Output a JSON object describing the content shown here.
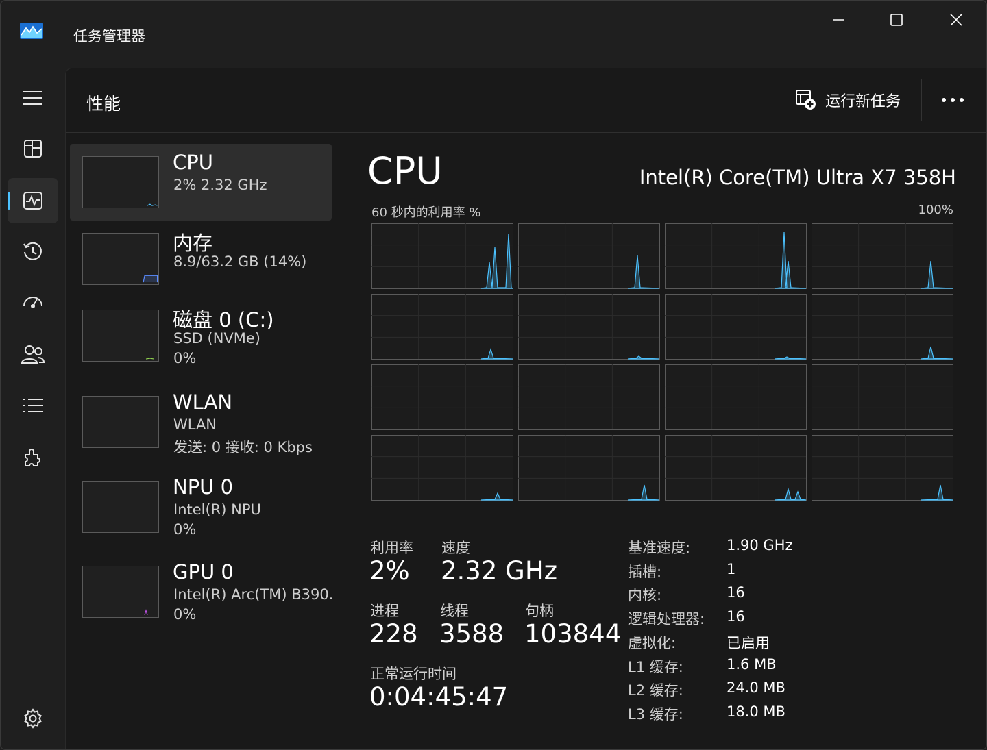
{
  "window": {
    "title": "任务管理器",
    "accent": "#4cc2ff"
  },
  "nav": {
    "items": [
      {
        "icon": "hamburger-menu-icon"
      },
      {
        "icon": "processes-icon"
      },
      {
        "icon": "performance-icon",
        "active": true
      },
      {
        "icon": "app-history-icon"
      },
      {
        "icon": "startup-apps-icon"
      },
      {
        "icon": "users-icon"
      },
      {
        "icon": "details-icon"
      },
      {
        "icon": "services-icon"
      },
      {
        "icon": "settings-icon"
      }
    ]
  },
  "header": {
    "title": "性能",
    "run_task": "运行新任务"
  },
  "devices": [
    {
      "name": "CPU",
      "line1": "2%  2.32 GHz",
      "line2": "",
      "color": "#4cc2ff"
    },
    {
      "name": "内存",
      "line1": "8.9/63.2 GB (14%)",
      "line2": "",
      "color": "#5b8cff"
    },
    {
      "name": "磁盘 0 (C:)",
      "line1": "SSD (NVMe)",
      "line2": "0%",
      "color": "#8fd14f"
    },
    {
      "name": "WLAN",
      "line1": "WLAN",
      "line2": "发送: 0  接收: 0 Kbps",
      "color": "#d27e3c"
    },
    {
      "name": "NPU 0",
      "line1": "Intel(R) NPU",
      "line2": "0%",
      "color": "#37c8c8"
    },
    {
      "name": "GPU 0",
      "line1": "Intel(R) Arc(TM) B390.",
      "line2": "0%",
      "color": "#c153e8"
    }
  ],
  "detail": {
    "title": "CPU",
    "model": "Intel(R) Core(TM) Ultra X7 358H",
    "graph_label": "60 秒内的利用率 %",
    "graph_max": "100%",
    "graph_color": "#4cc2ff",
    "stats": {
      "util_label": "利用率",
      "util_value": "2%",
      "speed_label": "速度",
      "speed_value": "2.32 GHz",
      "proc_label": "进程",
      "proc_value": "228",
      "threads_label": "线程",
      "threads_value": "3588",
      "handles_label": "句柄",
      "handles_value": "103844",
      "uptime_label": "正常运行时间",
      "uptime_value": "0:04:45:47"
    },
    "specs": [
      {
        "key": "基准速度:",
        "value": "1.90 GHz"
      },
      {
        "key": "插槽:",
        "value": "1"
      },
      {
        "key": "内核:",
        "value": "16"
      },
      {
        "key": "逻辑处理器:",
        "value": "16"
      },
      {
        "key": "虚拟化:",
        "value": "已启用"
      },
      {
        "key": "L1 缓存:",
        "value": "1.6 MB"
      },
      {
        "key": "L2 缓存:",
        "value": "24.0 MB"
      },
      {
        "key": "L3 缓存:",
        "value": "18.0 MB"
      }
    ]
  }
}
